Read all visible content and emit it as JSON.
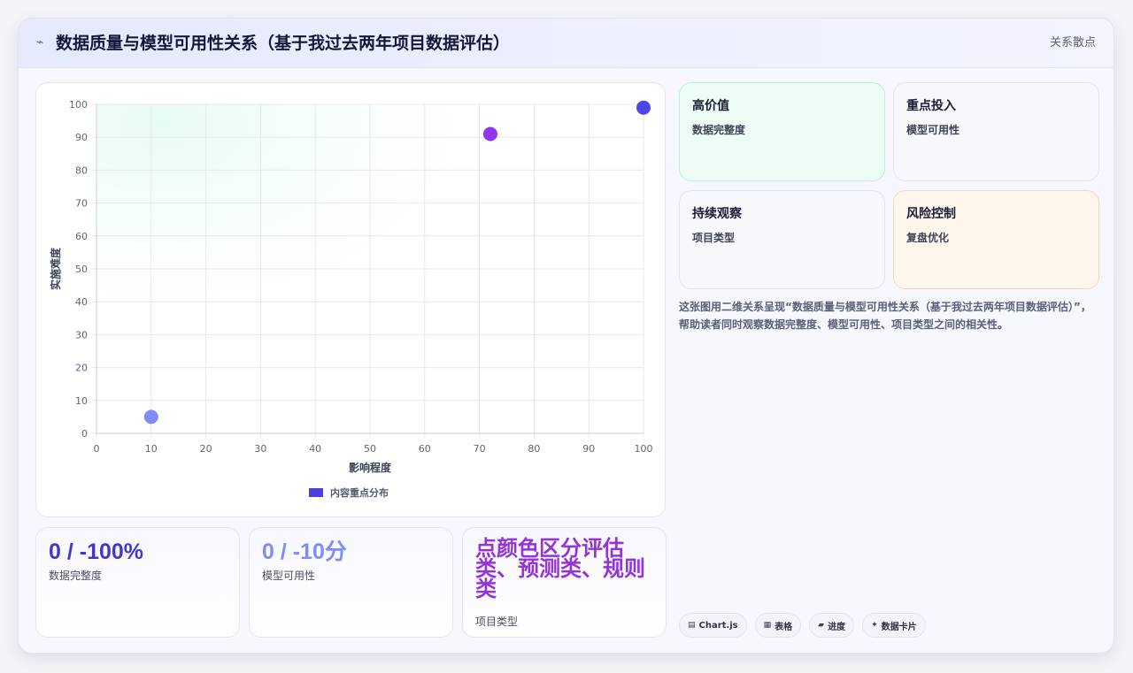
{
  "header": {
    "title": "数据质量与模型可用性关系（基于我过去两年项目数据评估）",
    "icon": "activity-icon",
    "right_label": "关系散点"
  },
  "chart_data": {
    "type": "scatter",
    "title": "",
    "xlabel": "影响程度",
    "ylabel": "实施难度",
    "xlim": [
      0,
      100
    ],
    "ylim": [
      0,
      100
    ],
    "x_ticks": [
      0,
      10,
      20,
      30,
      40,
      50,
      60,
      70,
      80,
      90,
      100
    ],
    "y_ticks": [
      0,
      10,
      20,
      30,
      40,
      50,
      60,
      70,
      80,
      90,
      100
    ],
    "grid": true,
    "legend": {
      "position": "bottom",
      "label": "内容重点分布",
      "color": "#4b3fe0"
    },
    "points": [
      {
        "x": 10,
        "y": 5,
        "color": "#818cf8"
      },
      {
        "x": 72,
        "y": 91,
        "color": "#9333ea"
      },
      {
        "x": 100,
        "y": 99,
        "color": "#4f46e5"
      }
    ]
  },
  "kpis": [
    {
      "value": "0 / -100%",
      "label": "数据完整度",
      "color": "#4338ca"
    },
    {
      "value": "0 / -10分",
      "label": "模型可用性",
      "color": "#818cf8"
    },
    {
      "value": "点颜色区分评估类、预测类、规则类",
      "label": "项目类型",
      "color": "#9333ea"
    }
  ],
  "quadrants": [
    {
      "title": "高价值",
      "subtitle": "数据完整度",
      "bg": "#ecfdf5",
      "border": "#bbf0d5"
    },
    {
      "title": "重点投入",
      "subtitle": "模型可用性",
      "bg": "#f7f8fc",
      "border": "#e0e4f2"
    },
    {
      "title": "持续观察",
      "subtitle": "项目类型",
      "bg": "#f7f8fc",
      "border": "#e0e4f2"
    },
    {
      "title": "风险控制",
      "subtitle": "复盘优化",
      "bg": "#fff7ed",
      "border": "#fbd5b3"
    }
  ],
  "description": "这张图用二维关系呈现“数据质量与模型可用性关系（基于我过去两年项目数据评估）”，帮助读者同时观察数据完整度、模型可用性、项目类型之间的相关性。",
  "chips": [
    {
      "icon": "chart-icon",
      "glyph": "▤",
      "label": "Chart.js"
    },
    {
      "icon": "table-icon",
      "glyph": "▦",
      "label": "表格"
    },
    {
      "icon": "progress-icon",
      "glyph": "▰",
      "label": "进度"
    },
    {
      "icon": "sparkle-icon",
      "glyph": "✦",
      "label": "数据卡片"
    }
  ]
}
